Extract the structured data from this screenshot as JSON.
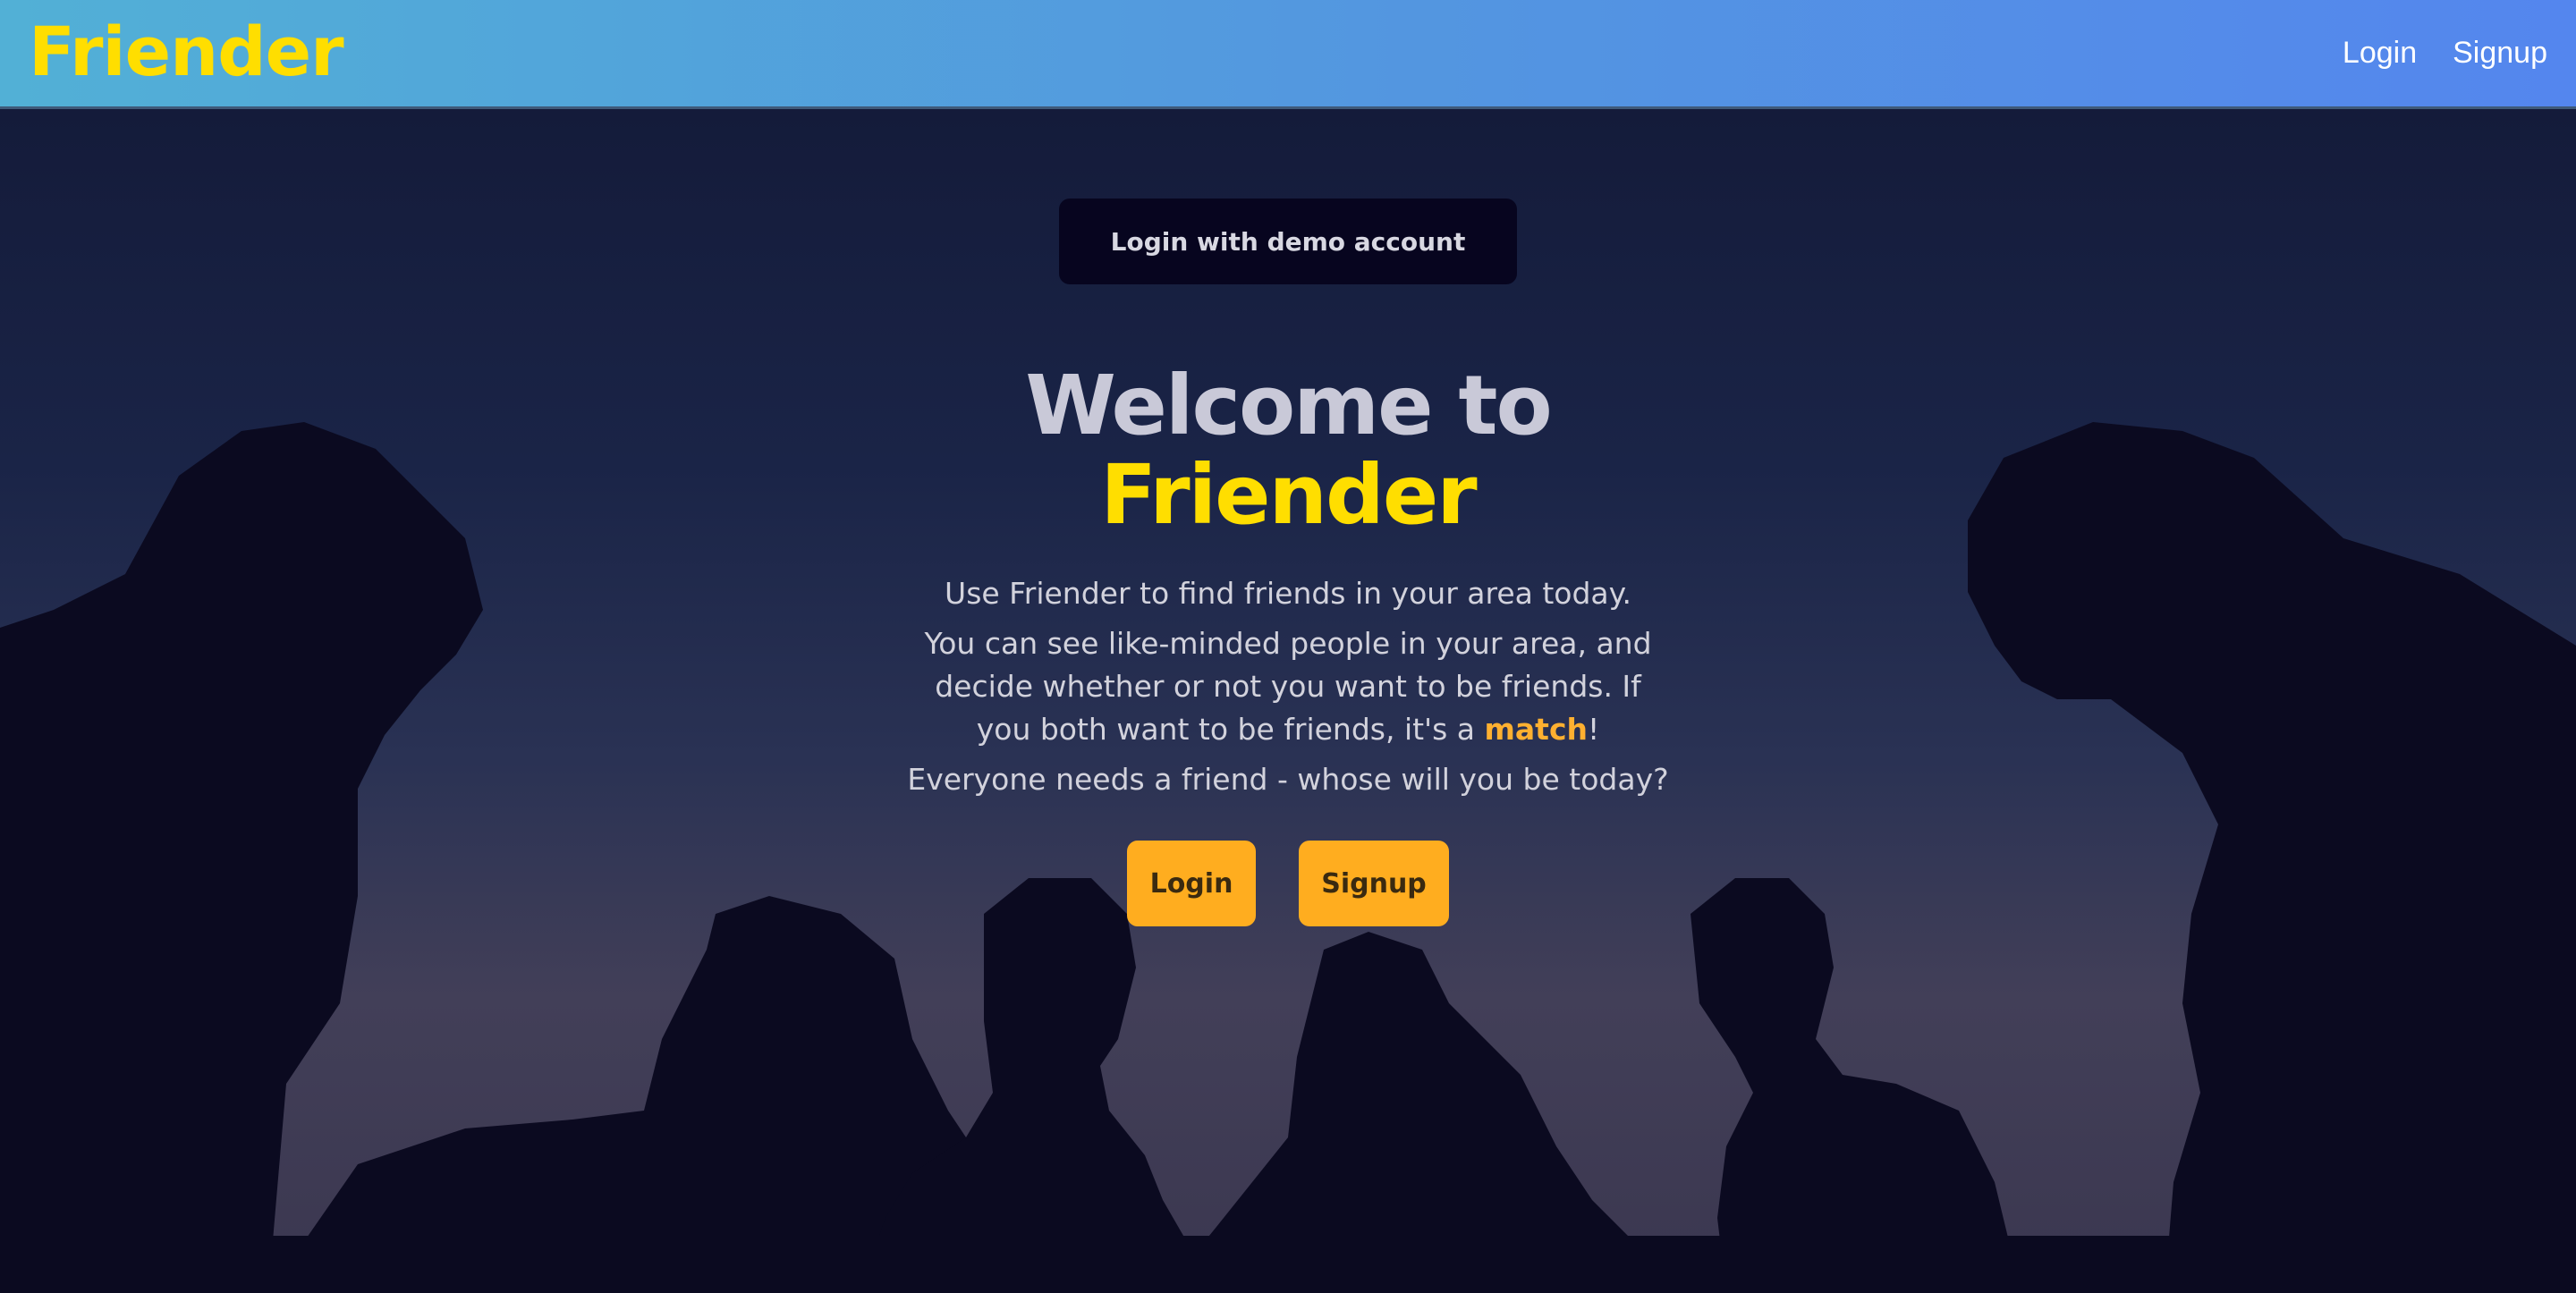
{
  "navbar": {
    "brand": "Friender",
    "links": [
      "Login",
      "Signup"
    ]
  },
  "hero": {
    "demo_button": "Login with demo account",
    "heading_line1": "Welcome to",
    "heading_line2": "Friender",
    "paragraph1": "Use Friender to find friends in your area today.",
    "paragraph2_before": "You can see like-minded people in your area, and decide whether or not you want to be friends. If you both want to be friends, it's a ",
    "paragraph2_highlight": "match",
    "paragraph2_after": "!",
    "paragraph3": "Everyone needs a friend - whose will you be today?",
    "login_button": "Login",
    "signup_button": "Signup"
  },
  "colors": {
    "brand_yellow": "#ffde00",
    "accent_orange": "#ffad1f",
    "highlight_orange": "#ffb030",
    "nav_gradient_start": "#52b0d6",
    "nav_gradient_end": "#5486ee"
  }
}
